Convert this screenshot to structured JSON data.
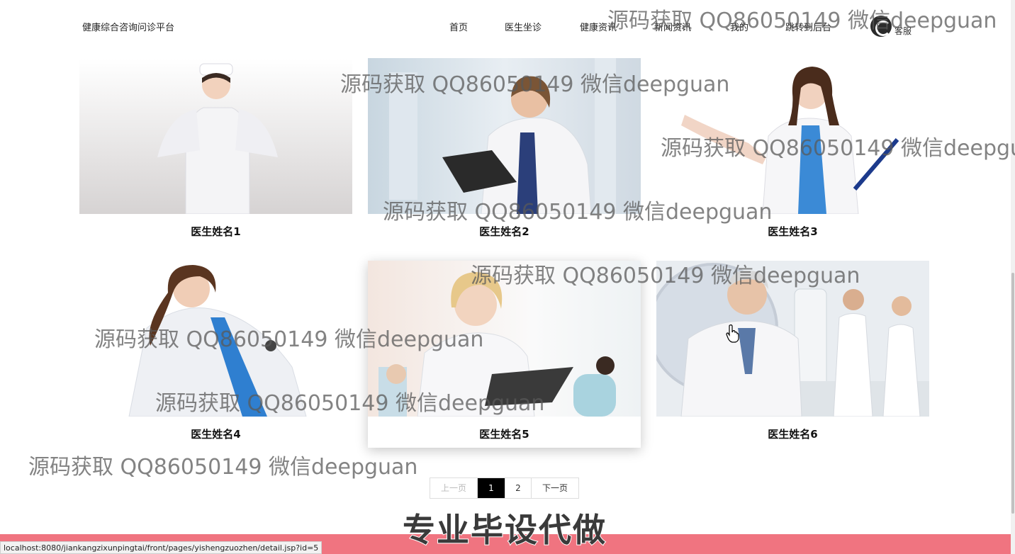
{
  "header": {
    "brand": "健康综合咨询问诊平台",
    "nav": [
      "首页",
      "医生坐诊",
      "健康资讯",
      "新闻资讯",
      "我的",
      "跳转到后台"
    ],
    "service_label": "客服"
  },
  "doctors": [
    {
      "name": "医生姓名1"
    },
    {
      "name": "医生姓名2"
    },
    {
      "name": "医生姓名3"
    },
    {
      "name": "医生姓名4"
    },
    {
      "name": "医生姓名5"
    },
    {
      "name": "医生姓名6"
    }
  ],
  "pagination": {
    "prev": "上一页",
    "pages": [
      "1",
      "2"
    ],
    "current": "1",
    "next": "下一页"
  },
  "overlay": {
    "watermark": "源码获取 QQ86050149 微信deepguan",
    "watermark_cut": "源码获取 QQ86050149 微信deepgu",
    "banner": "专业毕设代做"
  },
  "status_url": "localhost:8080/jiankangzixunpingtai/front/pages/yishengzuozhen/detail.jsp?id=5",
  "colors": {
    "footer_bar": "#f07480",
    "active_page": "#000000"
  }
}
